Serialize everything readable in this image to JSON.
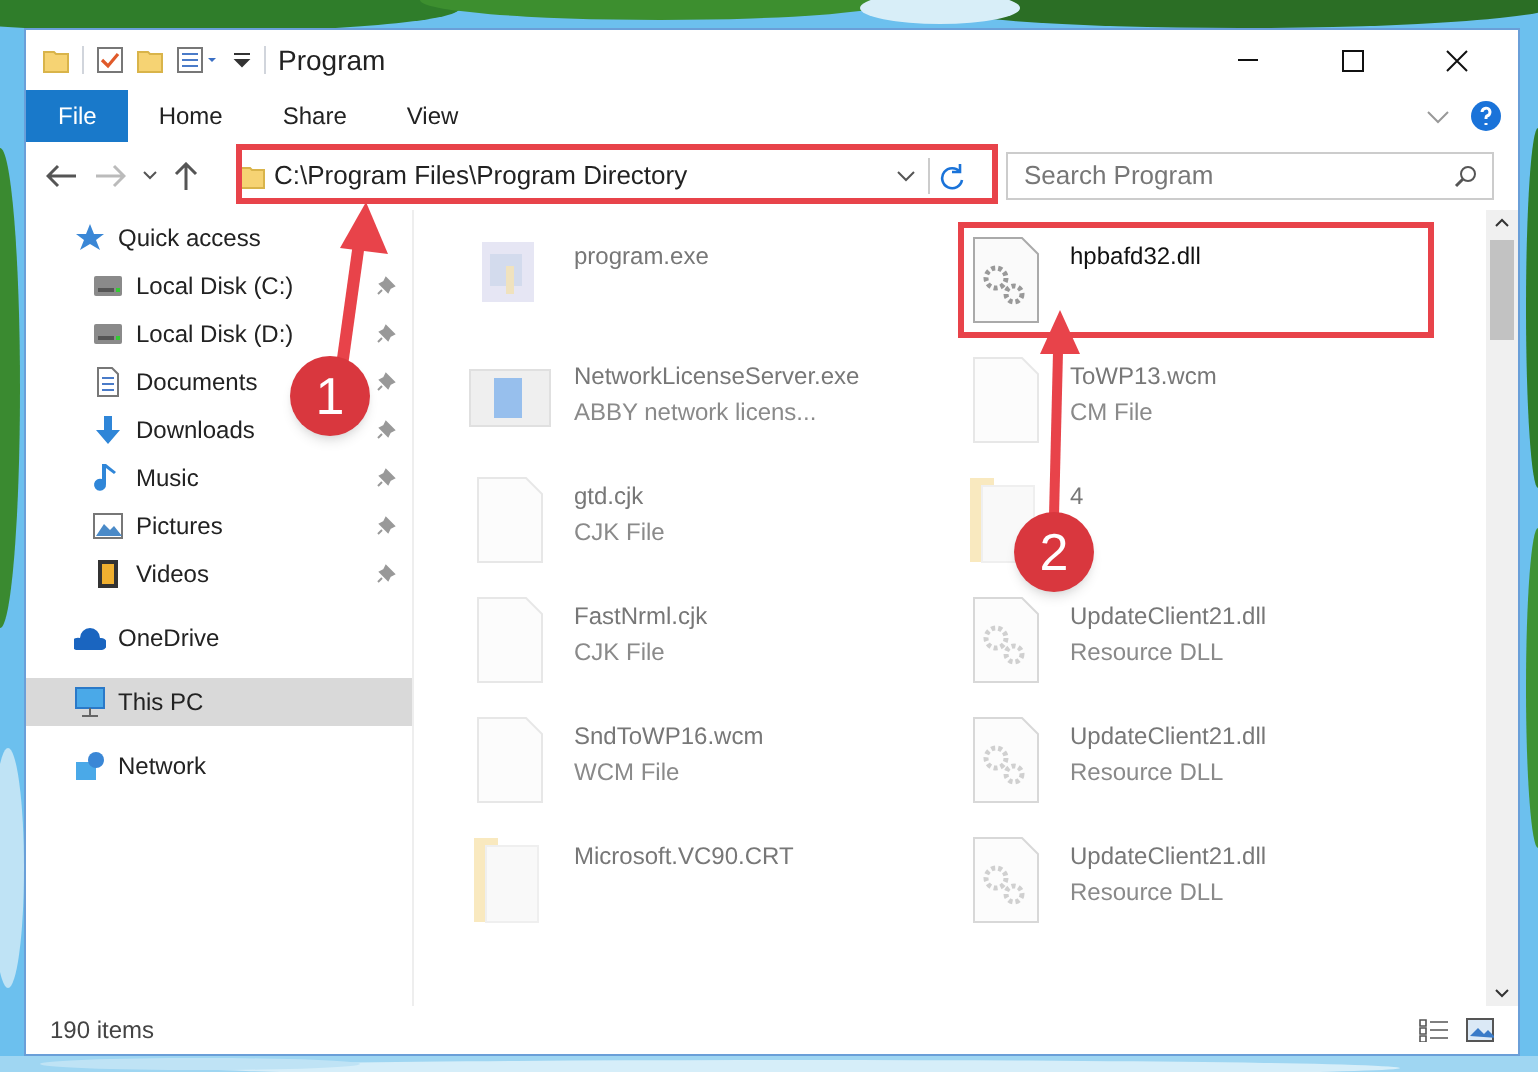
{
  "window": {
    "title": "Program"
  },
  "ribbon_tabs": [
    {
      "label": "File",
      "kind": "file"
    },
    {
      "label": "Home",
      "kind": "tab"
    },
    {
      "label": "Share",
      "kind": "tab"
    },
    {
      "label": "View",
      "kind": "tab"
    }
  ],
  "address": {
    "path": "C:\\Program Files\\Program Directory"
  },
  "search": {
    "placeholder": "Search Program"
  },
  "sidebar": {
    "items": [
      {
        "label": "Quick access",
        "kind": "star",
        "selected": false,
        "children": [
          {
            "label": "Local Disk (C:)",
            "kind": "drive",
            "pinned": true
          },
          {
            "label": "Local Disk (D:)",
            "kind": "drive",
            "pinned": true
          },
          {
            "label": "Documents",
            "kind": "document",
            "pinned": true
          },
          {
            "label": "Downloads",
            "kind": "download",
            "pinned": true
          },
          {
            "label": "Music",
            "kind": "music",
            "pinned": true
          },
          {
            "label": "Pictures",
            "kind": "pictures",
            "pinned": true
          },
          {
            "label": "Videos",
            "kind": "video",
            "pinned": true
          }
        ]
      },
      {
        "label": "OneDrive",
        "kind": "cloud",
        "selected": false
      },
      {
        "label": "This PC",
        "kind": "pc",
        "selected": true
      },
      {
        "label": "Network",
        "kind": "network",
        "selected": false
      }
    ]
  },
  "files": [
    {
      "name": "program.exe",
      "kind": "exe",
      "highlighted": false
    },
    {
      "name": "hpbafd32.dll",
      "kind": "dll",
      "highlighted": true
    },
    {
      "name": "NetworkLicenseServer.exe",
      "type": "ABBY network licens...",
      "kind": "app",
      "highlighted": false
    },
    {
      "name": "ToWP13.wcm",
      "type": "CM File",
      "kind": "file",
      "highlighted": false
    },
    {
      "name": "gtd.cjk",
      "type": "CJK File",
      "kind": "file",
      "highlighted": false
    },
    {
      "name": "4",
      "kind": "folder",
      "highlighted": false
    },
    {
      "name": "FastNrml.cjk",
      "type": "CJK File",
      "kind": "file",
      "highlighted": false
    },
    {
      "name": "UpdateClient21.dll",
      "type": "Resource DLL",
      "kind": "dll",
      "highlighted": false
    },
    {
      "name": "SndToWP16.wcm",
      "type": "WCM File",
      "kind": "file",
      "highlighted": false
    },
    {
      "name": "UpdateClient21.dll",
      "type": "Resource DLL",
      "kind": "dll",
      "highlighted": false
    },
    {
      "name": "Microsoft.VC90.CRT",
      "kind": "folder",
      "highlighted": false
    },
    {
      "name": "UpdateClient21.dll",
      "type": "Resource DLL",
      "kind": "dll",
      "highlighted": false
    }
  ],
  "status_bar": {
    "count": "190 items"
  },
  "annotations": [
    {
      "number": "1"
    },
    {
      "number": "2"
    }
  ]
}
